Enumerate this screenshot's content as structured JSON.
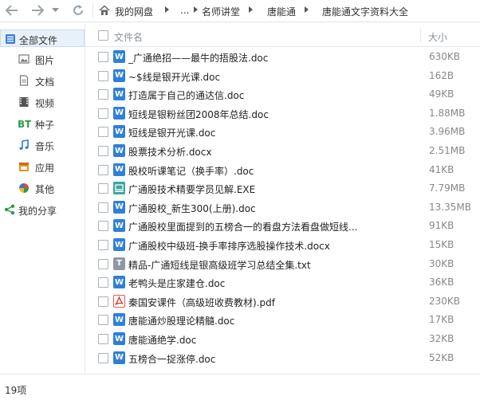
{
  "nav": {
    "breadcrumb": [
      "我的网盘",
      "...",
      "名师讲堂",
      "唐能通",
      "唐能通文字资料大全"
    ]
  },
  "sidebar": {
    "items": [
      {
        "label": "全部文件",
        "icon": "all-files-icon"
      },
      {
        "label": "图片",
        "icon": "image-icon"
      },
      {
        "label": "文档",
        "icon": "document-icon"
      },
      {
        "label": "视频",
        "icon": "video-icon"
      },
      {
        "label": "种子",
        "icon": "torrent-icon"
      },
      {
        "label": "音乐",
        "icon": "music-icon"
      },
      {
        "label": "应用",
        "icon": "app-icon"
      },
      {
        "label": "其他",
        "icon": "other-icon"
      },
      {
        "label": "我的分享",
        "icon": "share-icon"
      }
    ]
  },
  "list": {
    "columns": {
      "name": "文件名",
      "size": "大小"
    },
    "files": [
      {
        "name": "_广通绝招——最牛的捂股法.doc",
        "size": "630KB",
        "type": "word"
      },
      {
        "name": "~$线是银开光课.doc",
        "size": "162B",
        "type": "word"
      },
      {
        "name": "打造属于自己的通达信.doc",
        "size": "49KB",
        "type": "word"
      },
      {
        "name": "短线是银粉丝团2008年总结.doc",
        "size": "1.88MB",
        "type": "word"
      },
      {
        "name": "短线是银开光课.doc",
        "size": "3.96MB",
        "type": "word"
      },
      {
        "name": "股票技术分析.docx",
        "size": "2.51MB",
        "type": "word"
      },
      {
        "name": "股校听课笔记（换手率）.doc",
        "size": "41KB",
        "type": "word"
      },
      {
        "name": "广通股技术精要学员见解.EXE",
        "size": "7.79MB",
        "type": "exe"
      },
      {
        "name": "广通股校_新生300(上册).doc",
        "size": "13.35MB",
        "type": "word"
      },
      {
        "name": "广通股校里面提到的五榜合一的看盘方法看盘做短线...",
        "size": "91KB",
        "type": "word"
      },
      {
        "name": "广通股校中级班-换手率排序选股操作技术.docx",
        "size": "15KB",
        "type": "word"
      },
      {
        "name": "精品-广通短线是银高级班学习总结全集.txt",
        "size": "30KB",
        "type": "txt"
      },
      {
        "name": "老鸭头是庄家建仓.doc",
        "size": "36KB",
        "type": "word"
      },
      {
        "name": "秦国安课件（高级班收费教材).pdf",
        "size": "230KB",
        "type": "pdf"
      },
      {
        "name": "唐能通炒股理论精髓.doc",
        "size": "17KB",
        "type": "word"
      },
      {
        "name": "唐能通绝学.doc",
        "size": "32KB",
        "type": "word"
      },
      {
        "name": "五榜合一捉涨停.doc",
        "size": "52KB",
        "type": "word"
      }
    ]
  },
  "status": {
    "count": "19项"
  },
  "colors": {
    "word": "#2f7fd8",
    "exe": "#3aa6a0",
    "txt": "#8e98a3",
    "pdf": "#d9342b"
  }
}
